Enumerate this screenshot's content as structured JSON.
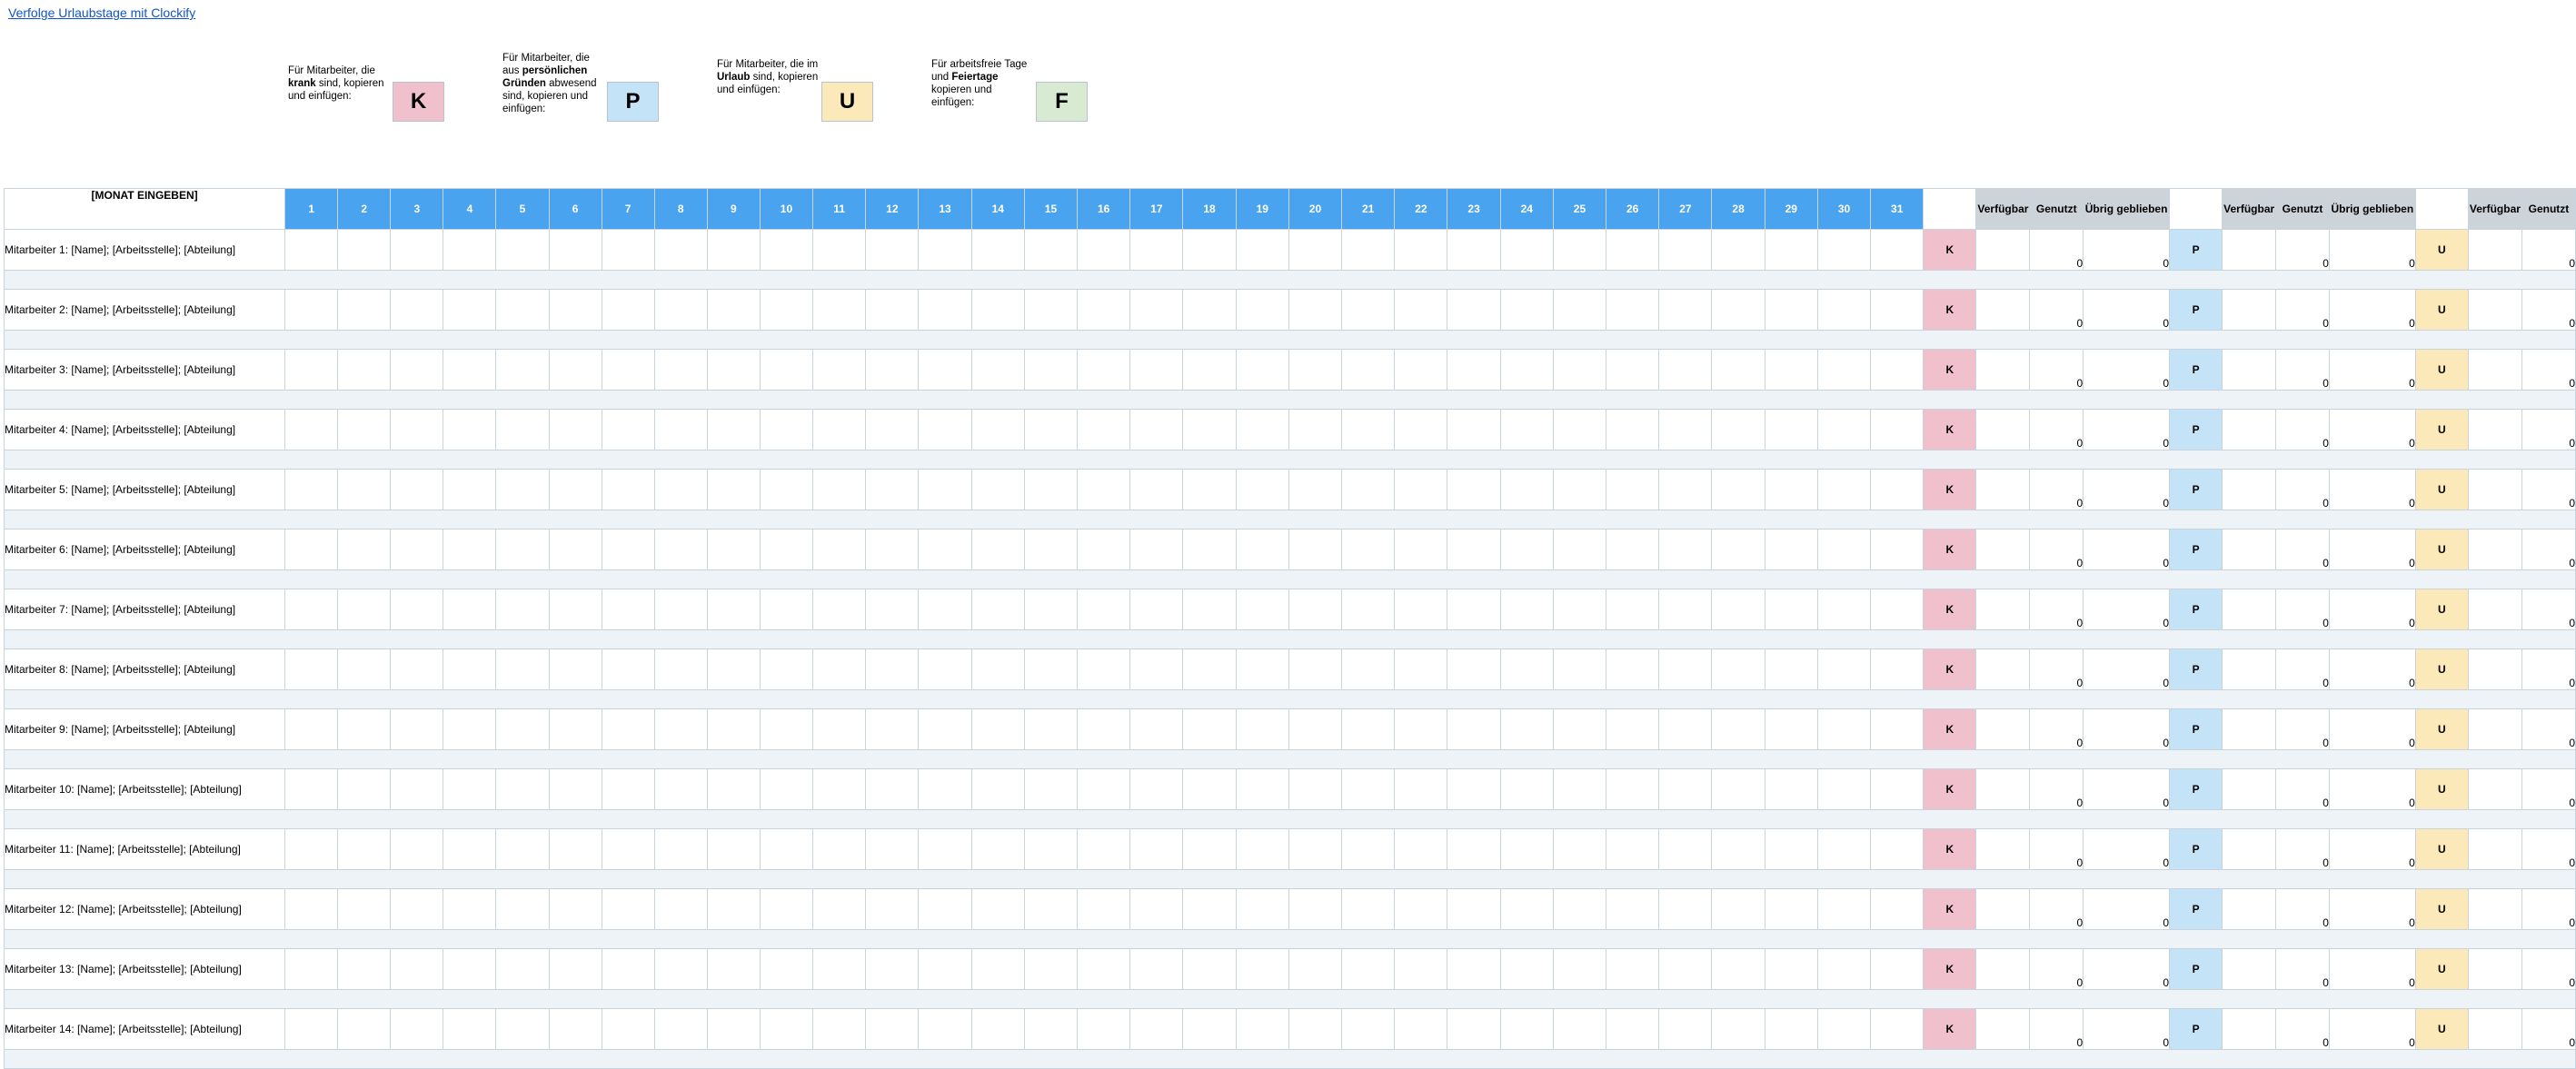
{
  "link": {
    "text": "Verfolge Urlaubstage mit Clockify"
  },
  "legend": [
    {
      "pre": "Für Mitarbeiter, die ",
      "bold": "krank",
      "post": " sind, kopieren und einfügen:",
      "code": "K",
      "color": "#f1c0cd"
    },
    {
      "pre": "Für Mitarbeiter, die aus ",
      "bold": "persönlichen Gründen",
      "post": " abwesend sind, kopieren und einfügen:",
      "code": "P",
      "color": "#c4e3f7"
    },
    {
      "pre": "Für Mitarbeiter, die im ",
      "bold": "Urlaub",
      "post": " sind, kopieren und einfügen:",
      "code": "U",
      "color": "#fbe9ba"
    },
    {
      "pre": "Für arbeitsfreie Tage und ",
      "bold": "Feiertage",
      "post": " kopieren und einfügen:",
      "code": "F",
      "color": "#d9ead3"
    }
  ],
  "table": {
    "month_label": "[MONAT EINGEBEN]",
    "days": [
      "1",
      "2",
      "3",
      "4",
      "5",
      "6",
      "7",
      "8",
      "9",
      "10",
      "11",
      "12",
      "13",
      "14",
      "15",
      "16",
      "17",
      "18",
      "19",
      "20",
      "21",
      "22",
      "23",
      "24",
      "25",
      "26",
      "27",
      "28",
      "29",
      "30",
      "31"
    ],
    "stat_headers": [
      "Verfügbar",
      "Genutzt",
      "Übrig geblieben"
    ],
    "codes": [
      "K",
      "P",
      "U"
    ],
    "employees": [
      "Mitarbeiter 1: [Name]; [Arbeitsstelle]; [Abteilung]",
      "Mitarbeiter 2: [Name]; [Arbeitsstelle]; [Abteilung]",
      "Mitarbeiter 3: [Name]; [Arbeitsstelle]; [Abteilung]",
      "Mitarbeiter 4: [Name]; [Arbeitsstelle]; [Abteilung]",
      "Mitarbeiter 5: [Name]; [Arbeitsstelle]; [Abteilung]",
      "Mitarbeiter 6: [Name]; [Arbeitsstelle]; [Abteilung]",
      "Mitarbeiter 7: [Name]; [Arbeitsstelle]; [Abteilung]",
      "Mitarbeiter 8: [Name]; [Arbeitsstelle]; [Abteilung]",
      "Mitarbeiter 9: [Name]; [Arbeitsstelle]; [Abteilung]",
      "Mitarbeiter 10: [Name]; [Arbeitsstelle]; [Abteilung]",
      "Mitarbeiter 11: [Name]; [Arbeitsstelle]; [Abteilung]",
      "Mitarbeiter 12: [Name]; [Arbeitsstelle]; [Abteilung]",
      "Mitarbeiter 13: [Name]; [Arbeitsstelle]; [Abteilung]",
      "Mitarbeiter 14: [Name]; [Arbeitsstelle]; [Abteilung]"
    ],
    "used_value": "0",
    "remaining_value": "0"
  }
}
